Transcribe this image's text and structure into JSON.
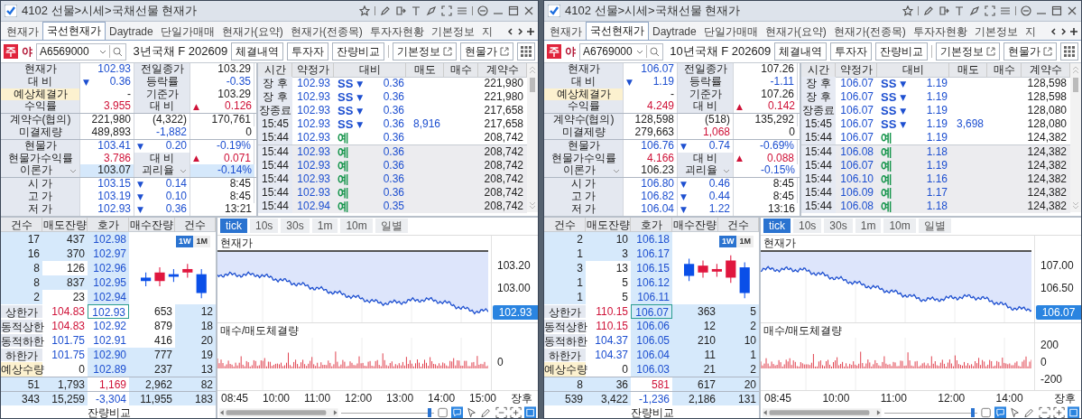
{
  "panels": [
    {
      "title": "4102 선물>시세>국채선물 현재가",
      "tabs": [
        {
          "label": "현재가",
          "selected": false
        },
        {
          "label": "국선현재가",
          "selected": true
        },
        {
          "label": "Daytrade",
          "selected": false
        },
        {
          "label": "단일가매매",
          "selected": false
        },
        {
          "label": "현재가(요약)",
          "selected": false
        },
        {
          "label": "현재가(전종목)",
          "selected": false
        },
        {
          "label": "투자자현황",
          "selected": false
        },
        {
          "label": "기본정보",
          "selected": false
        },
        {
          "label": "지",
          "selected": false
        }
      ],
      "session_badge": "주",
      "session_label": "야",
      "code": "A6569000",
      "instrument": "3년국채 F 202609",
      "buttons": [
        {
          "label": "체결내역",
          "kind": "plain"
        },
        {
          "label": "투자자",
          "kind": "plain"
        },
        {
          "label": "잔량비교",
          "kind": "plain"
        },
        {
          "label": "기본정보",
          "kind": "external"
        },
        {
          "label": "현물가",
          "kind": "external"
        }
      ],
      "quote": [
        [
          [
            {
              "text": "현재가",
              "kind": "label"
            },
            {
              "text": "102.93",
              "kind": "value",
              "color": "#1d4fd0"
            },
            {
              "text": "전일종가",
              "kind": "label"
            },
            {
              "text": "103.29",
              "kind": "value"
            }
          ],
          [
            {
              "text": "대 비",
              "kind": "label"
            },
            {
              "text": "0.36",
              "kind": "value",
              "color": "#1d4fd0",
              "arrow": "▼"
            },
            {
              "text": "등락률",
              "kind": "label"
            },
            {
              "text": "-0.35",
              "kind": "value",
              "color": "#1d4fd0"
            }
          ],
          [
            {
              "text": "예상체결가",
              "kind": "note"
            },
            {
              "text": "-",
              "kind": "value"
            },
            {
              "text": "기준가",
              "kind": "label"
            },
            {
              "text": "103.29",
              "kind": "value"
            }
          ],
          [
            {
              "text": "수익률",
              "kind": "label"
            },
            {
              "text": "3.955",
              "kind": "value",
              "color": "#cf1238"
            },
            {
              "text": "대 비",
              "kind": "label"
            },
            {
              "text": "0.126",
              "kind": "value",
              "color": "#cf1238",
              "arrow": "▲"
            }
          ]
        ],
        [
          [
            {
              "text": "계약수(협의)",
              "kind": "label"
            },
            {
              "text": "221,980",
              "kind": "value"
            },
            {
              "text": "(4,322)",
              "kind": "value"
            },
            {
              "text": "170,761",
              "kind": "value"
            }
          ],
          [
            {
              "text": "미결제량",
              "kind": "label"
            },
            {
              "text": "489,893",
              "kind": "value"
            },
            {
              "text": "-1,882",
              "kind": "value",
              "color": "#1d4fd0"
            },
            {
              "text": "0",
              "kind": "value"
            }
          ]
        ],
        [
          [
            {
              "text": "현물가",
              "kind": "label"
            },
            {
              "text": "103.41",
              "kind": "value",
              "color": "#1d4fd0"
            },
            {
              "text": "0.20",
              "kind": "value",
              "color": "#1d4fd0",
              "arrow": "▼"
            },
            {
              "text": "-0.19%",
              "kind": "value",
              "color": "#1d4fd0"
            }
          ],
          [
            {
              "text": "현물가수익률",
              "kind": "label"
            },
            {
              "text": "3.786",
              "kind": "value",
              "color": "#cf1238"
            },
            {
              "text": "대 비",
              "kind": "label"
            },
            {
              "text": "0.071",
              "kind": "value",
              "color": "#cf1238",
              "arrow": "▲"
            }
          ],
          [
            {
              "text": "이론가",
              "kind": "label-dropdown"
            },
            {
              "text": "103.07",
              "kind": "value-hl"
            },
            {
              "text": "괴리율",
              "kind": "label-dropdown"
            },
            {
              "text": "-0.14%",
              "kind": "value-hl",
              "color": "#1d4fd0"
            }
          ]
        ],
        [
          [
            {
              "text": "시 가",
              "kind": "label"
            },
            {
              "text": "103.15",
              "kind": "value",
              "color": "#1d4fd0"
            },
            {
              "text": "0.14",
              "kind": "value",
              "color": "#1d4fd0",
              "arrow": "▼"
            },
            {
              "text": "8:45",
              "kind": "value"
            }
          ],
          [
            {
              "text": "고 가",
              "kind": "label"
            },
            {
              "text": "103.19",
              "kind": "value",
              "color": "#1d4fd0"
            },
            {
              "text": "0.10",
              "kind": "value",
              "color": "#1d4fd0",
              "arrow": "▼"
            },
            {
              "text": "8:45",
              "kind": "value"
            }
          ],
          [
            {
              "text": "저 가",
              "kind": "label"
            },
            {
              "text": "102.93",
              "kind": "value",
              "color": "#1d4fd0"
            },
            {
              "text": "0.36",
              "kind": "value",
              "color": "#1d4fd0",
              "arrow": "▼"
            },
            {
              "text": "13:21",
              "kind": "value"
            }
          ]
        ]
      ],
      "trades": {
        "columns": [
          "시간",
          "약정가",
          "대비",
          "매도",
          "매수",
          "계약수"
        ],
        "rows": [
          {
            "time": "장 후",
            "price": "102.93",
            "flag": "SS",
            "color": "#1d4fd0",
            "arrow": "▼",
            "change": "0.36",
            "volume": "221,980",
            "shaded": false
          },
          {
            "time": "장 후",
            "price": "102.93",
            "flag": "SS",
            "color": "#1d4fd0",
            "arrow": "▼",
            "change": "0.36",
            "volume": "221,980",
            "shaded": false
          },
          {
            "time": "장종료",
            "price": "102.93",
            "flag": "SS",
            "color": "#1d4fd0",
            "arrow": "▼",
            "change": "0.36",
            "volume": "217,658",
            "shaded": false
          },
          {
            "time": "15:45",
            "price": "102.93",
            "flag": "SS",
            "color": "#1d4fd0",
            "arrow": "▼",
            "change": "0.36",
            "sell": "8,916",
            "volume": "217,658",
            "shaded": false
          },
          {
            "time": "15:44",
            "price": "102.93",
            "flag": "예",
            "color": "#14944a",
            "change": "0.36",
            "volume": "208,742",
            "shaded": false
          },
          {
            "time": "15:44",
            "price": "102.93",
            "flag": "예",
            "color": "#14944a",
            "change": "0.36",
            "volume": "208,742",
            "shaded": true
          },
          {
            "time": "15:44",
            "price": "102.93",
            "flag": "예",
            "color": "#14944a",
            "change": "0.36",
            "volume": "208,742",
            "shaded": true
          },
          {
            "time": "15:44",
            "price": "102.93",
            "flag": "예",
            "color": "#14944a",
            "change": "0.36",
            "volume": "208,742",
            "shaded": true
          },
          {
            "time": "15:44",
            "price": "102.93",
            "flag": "예",
            "color": "#14944a",
            "change": "0.36",
            "volume": "208,742",
            "shaded": true
          },
          {
            "time": "15:44",
            "price": "102.94",
            "flag": "예",
            "color": "#14944a",
            "change": "0.35",
            "volume": "208,742",
            "shaded": true
          }
        ]
      },
      "orderbook": {
        "columns": [
          "건수",
          "매도잔량",
          "호가",
          "매수잔량",
          "건수"
        ],
        "range_toggle": [
          {
            "label": "1W",
            "selected": true
          },
          {
            "label": "1M",
            "selected": false
          }
        ],
        "asks": [
          {
            "count": "17",
            "qty": "437",
            "price": "102.98",
            "shaded": true
          },
          {
            "count": "16",
            "qty": "370",
            "price": "102.97",
            "shaded": true
          },
          {
            "count": "8",
            "qty": "126",
            "price": "102.96",
            "shaded": false
          },
          {
            "count": "8",
            "qty": "837",
            "price": "102.95",
            "shaded": true
          },
          {
            "count": "2",
            "qty": "23",
            "price": "102.94",
            "shaded": false
          }
        ],
        "bids": [
          {
            "label": "상한가",
            "kind": "label",
            "limit": "104.83",
            "color": "#cf1238",
            "price": "102.93",
            "qty": "653",
            "count": "12",
            "current": true,
            "shaded": false
          },
          {
            "label": "동적상한",
            "kind": "label",
            "limit": "104.83",
            "color": "#cf1238",
            "price": "102.92",
            "qty": "879",
            "count": "18",
            "current": false,
            "shaded": false
          },
          {
            "label": "동적하한",
            "kind": "label",
            "limit": "101.75",
            "color": "#1d4fd0",
            "price": "102.91",
            "qty": "416",
            "count": "20",
            "current": false,
            "shaded": false
          },
          {
            "label": "하한가",
            "kind": "label",
            "limit": "101.75",
            "color": "#1d4fd0",
            "price": "102.90",
            "qty": "777",
            "count": "19",
            "current": false,
            "shaded": true
          },
          {
            "label": "예상수량",
            "kind": "note",
            "limit": "0",
            "price": "102.89",
            "qty": "237",
            "count": "13",
            "current": false,
            "shaded": true
          }
        ],
        "totals": [
          {
            "cells": [
              "51",
              "1,793",
              "1,169",
              "2,962",
              "82"
            ],
            "color": "#cf1238"
          },
          {
            "cells": [
              "343",
              "15,259",
              "-3,304",
              "11,955",
              "183"
            ],
            "color": "#1d4fd0"
          }
        ],
        "footer": "잔량비교"
      },
      "chart": {
        "intervals": [
          {
            "label": "tick",
            "selected": true
          },
          {
            "label": "10s",
            "selected": false
          },
          {
            "label": "30s",
            "selected": false
          },
          {
            "label": "1m",
            "selected": false
          },
          {
            "label": "10m",
            "selected": false
          },
          {
            "label": "일별",
            "selected": false
          }
        ],
        "zoom": {
          "level": 0.97
        },
        "price_title": "현재가",
        "price_ticks": [
          "103.20",
          "103.00"
        ],
        "price_tag": "102.93",
        "volume_title": "매수/매도체결량",
        "volume_ticks": [
          "0"
        ],
        "time_labels": [
          "08:45",
          "10:00",
          "11:00",
          "12:00",
          "13:00",
          "14:00",
          "15:00",
          "장후"
        ]
      }
    },
    {
      "title": "4102 선물>시세>국채선물 현재가",
      "tabs": [
        {
          "label": "현재가",
          "selected": false
        },
        {
          "label": "국선현재가",
          "selected": true
        },
        {
          "label": "Daytrade",
          "selected": false
        },
        {
          "label": "단일가매매",
          "selected": false
        },
        {
          "label": "현재가(요약)",
          "selected": false
        },
        {
          "label": "현재가(전종목)",
          "selected": false
        },
        {
          "label": "투자자현황",
          "selected": false
        },
        {
          "label": "기본정보",
          "selected": false
        },
        {
          "label": "지",
          "selected": false
        }
      ],
      "session_badge": "주",
      "session_label": "야",
      "code": "A6769000",
      "instrument": "10년국채 F 202609",
      "buttons": [
        {
          "label": "체결내역",
          "kind": "plain"
        },
        {
          "label": "투자자",
          "kind": "plain"
        },
        {
          "label": "잔량비교",
          "kind": "plain"
        },
        {
          "label": "기본정보",
          "kind": "external"
        },
        {
          "label": "현물가",
          "kind": "external"
        }
      ],
      "quote": [
        [
          [
            {
              "text": "현재가",
              "kind": "label"
            },
            {
              "text": "106.07",
              "kind": "value",
              "color": "#1d4fd0"
            },
            {
              "text": "전일종가",
              "kind": "label"
            },
            {
              "text": "107.26",
              "kind": "value"
            }
          ],
          [
            {
              "text": "대 비",
              "kind": "label"
            },
            {
              "text": "1.19",
              "kind": "value",
              "color": "#1d4fd0",
              "arrow": "▼"
            },
            {
              "text": "등락률",
              "kind": "label"
            },
            {
              "text": "-1.11",
              "kind": "value",
              "color": "#1d4fd0"
            }
          ],
          [
            {
              "text": "예상체결가",
              "kind": "note"
            },
            {
              "text": "-",
              "kind": "value"
            },
            {
              "text": "기준가",
              "kind": "label"
            },
            {
              "text": "107.26",
              "kind": "value"
            }
          ],
          [
            {
              "text": "수익률",
              "kind": "label"
            },
            {
              "text": "4.249",
              "kind": "value",
              "color": "#cf1238"
            },
            {
              "text": "대 비",
              "kind": "label"
            },
            {
              "text": "0.142",
              "kind": "value",
              "color": "#cf1238",
              "arrow": "▲"
            }
          ]
        ],
        [
          [
            {
              "text": "계약수(협의)",
              "kind": "label"
            },
            {
              "text": "128,598",
              "kind": "value"
            },
            {
              "text": "(518)",
              "kind": "value"
            },
            {
              "text": "135,292",
              "kind": "value"
            }
          ],
          [
            {
              "text": "미결제량",
              "kind": "label"
            },
            {
              "text": "279,663",
              "kind": "value"
            },
            {
              "text": "1,068",
              "kind": "value",
              "color": "#cf1238"
            },
            {
              "text": "0",
              "kind": "value"
            }
          ]
        ],
        [
          [
            {
              "text": "현물가",
              "kind": "label"
            },
            {
              "text": "106.76",
              "kind": "value",
              "color": "#1d4fd0"
            },
            {
              "text": "0.74",
              "kind": "value",
              "color": "#1d4fd0",
              "arrow": "▼"
            },
            {
              "text": "-0.69%",
              "kind": "value",
              "color": "#1d4fd0"
            }
          ],
          [
            {
              "text": "현물가수익률",
              "kind": "label"
            },
            {
              "text": "4.166",
              "kind": "value",
              "color": "#cf1238"
            },
            {
              "text": "대 비",
              "kind": "label"
            },
            {
              "text": "0.088",
              "kind": "value",
              "color": "#cf1238",
              "arrow": "▲"
            }
          ],
          [
            {
              "text": "이론가",
              "kind": "label-dropdown"
            },
            {
              "text": "106.23",
              "kind": "value"
            },
            {
              "text": "괴리율",
              "kind": "label-dropdown"
            },
            {
              "text": "-0.15%",
              "kind": "value",
              "color": "#1d4fd0"
            }
          ]
        ],
        [
          [
            {
              "text": "시 가",
              "kind": "label"
            },
            {
              "text": "106.80",
              "kind": "value",
              "color": "#1d4fd0"
            },
            {
              "text": "0.46",
              "kind": "value",
              "color": "#1d4fd0",
              "arrow": "▼"
            },
            {
              "text": "8:45",
              "kind": "value"
            }
          ],
          [
            {
              "text": "고 가",
              "kind": "label"
            },
            {
              "text": "106.82",
              "kind": "value",
              "color": "#1d4fd0"
            },
            {
              "text": "0.44",
              "kind": "value",
              "color": "#1d4fd0",
              "arrow": "▼"
            },
            {
              "text": "8:45",
              "kind": "value"
            }
          ],
          [
            {
              "text": "저 가",
              "kind": "label"
            },
            {
              "text": "106.04",
              "kind": "value",
              "color": "#1d4fd0"
            },
            {
              "text": "1.22",
              "kind": "value",
              "color": "#1d4fd0",
              "arrow": "▼"
            },
            {
              "text": "13:16",
              "kind": "value"
            }
          ]
        ]
      ],
      "trades": {
        "columns": [
          "시간",
          "약정가",
          "대비",
          "매도",
          "매수",
          "계약수"
        ],
        "rows": [
          {
            "time": "장 후",
            "price": "106.07",
            "flag": "SS",
            "color": "#1d4fd0",
            "arrow": "▼",
            "change": "1.19",
            "volume": "128,598",
            "shaded": false
          },
          {
            "time": "장 후",
            "price": "106.07",
            "flag": "SS",
            "color": "#1d4fd0",
            "arrow": "▼",
            "change": "1.19",
            "volume": "128,598",
            "shaded": false
          },
          {
            "time": "장종료",
            "price": "106.07",
            "flag": "SS",
            "color": "#1d4fd0",
            "arrow": "▼",
            "change": "1.19",
            "volume": "128,080",
            "shaded": false
          },
          {
            "time": "15:45",
            "price": "106.07",
            "flag": "SS",
            "color": "#1d4fd0",
            "arrow": "▼",
            "change": "1.19",
            "sell": "3,698",
            "volume": "128,080",
            "shaded": false
          },
          {
            "time": "15:44",
            "price": "106.07",
            "flag": "예",
            "color": "#14944a",
            "change": "1.19",
            "volume": "124,382",
            "shaded": false
          },
          {
            "time": "15:44",
            "price": "106.08",
            "flag": "예",
            "color": "#14944a",
            "change": "1.18",
            "volume": "124,382",
            "shaded": true
          },
          {
            "time": "15:44",
            "price": "106.07",
            "flag": "예",
            "color": "#14944a",
            "change": "1.19",
            "volume": "124,382",
            "shaded": true
          },
          {
            "time": "15:44",
            "price": "106.10",
            "flag": "예",
            "color": "#14944a",
            "change": "1.16",
            "volume": "124,382",
            "shaded": true
          },
          {
            "time": "15:44",
            "price": "106.09",
            "flag": "예",
            "color": "#14944a",
            "change": "1.17",
            "volume": "124,382",
            "shaded": true
          },
          {
            "time": "15:44",
            "price": "106.08",
            "flag": "예",
            "color": "#14944a",
            "change": "1.18",
            "volume": "124,382",
            "shaded": true
          }
        ]
      },
      "orderbook": {
        "columns": [
          "건수",
          "매도잔량",
          "호가",
          "매수잔량",
          "건수"
        ],
        "range_toggle": [
          {
            "label": "1W",
            "selected": true
          },
          {
            "label": "1M",
            "selected": false
          }
        ],
        "asks": [
          {
            "count": "2",
            "qty": "10",
            "price": "106.18",
            "shaded": true
          },
          {
            "count": "1",
            "qty": "3",
            "price": "106.17",
            "shaded": true
          },
          {
            "count": "3",
            "qty": "13",
            "price": "106.15",
            "shaded": false
          },
          {
            "count": "1",
            "qty": "5",
            "price": "106.12",
            "shaded": false
          },
          {
            "count": "1",
            "qty": "5",
            "price": "106.11",
            "shaded": false
          }
        ],
        "bids": [
          {
            "label": "상한가",
            "kind": "label",
            "limit": "110.15",
            "color": "#cf1238",
            "price": "106.07",
            "qty": "363",
            "count": "5",
            "current": true,
            "shaded": true
          },
          {
            "label": "동적상한",
            "kind": "label",
            "limit": "110.15",
            "color": "#cf1238",
            "price": "106.06",
            "qty": "12",
            "count": "2",
            "current": false,
            "shaded": true
          },
          {
            "label": "동적하한",
            "kind": "label",
            "limit": "104.37",
            "color": "#1d4fd0",
            "price": "106.05",
            "qty": "210",
            "count": "10",
            "current": false,
            "shaded": true
          },
          {
            "label": "하한가",
            "kind": "label",
            "limit": "104.37",
            "color": "#1d4fd0",
            "price": "106.04",
            "qty": "11",
            "count": "1",
            "current": false,
            "shaded": true
          },
          {
            "label": "예상수량",
            "kind": "note",
            "limit": "0",
            "price": "106.03",
            "qty": "21",
            "count": "2",
            "current": false,
            "shaded": true
          }
        ],
        "totals": [
          {
            "cells": [
              "8",
              "36",
              "581",
              "617",
              "20"
            ],
            "color": "#cf1238"
          },
          {
            "cells": [
              "539",
              "3,422",
              "-1,236",
              "2,186",
              "131"
            ],
            "color": "#1d4fd0"
          }
        ],
        "footer": "잔량비교"
      },
      "chart": {
        "intervals": [
          {
            "label": "tick",
            "selected": true
          },
          {
            "label": "10s",
            "selected": false
          },
          {
            "label": "30s",
            "selected": false
          },
          {
            "label": "1m",
            "selected": false
          },
          {
            "label": "10m",
            "selected": false
          },
          {
            "label": "일별",
            "selected": false
          }
        ],
        "zoom": {
          "level": 0.97
        },
        "price_title": "현재가",
        "price_ticks": [
          "107.00",
          "106.50"
        ],
        "price_tag": "106.07",
        "volume_title": "매수/매도체결량",
        "volume_ticks": [
          "200",
          "0",
          "-200"
        ],
        "time_labels": [
          "08:45",
          "10:00",
          "11:00",
          "12:00",
          "14:00",
          "장후"
        ]
      }
    }
  ]
}
